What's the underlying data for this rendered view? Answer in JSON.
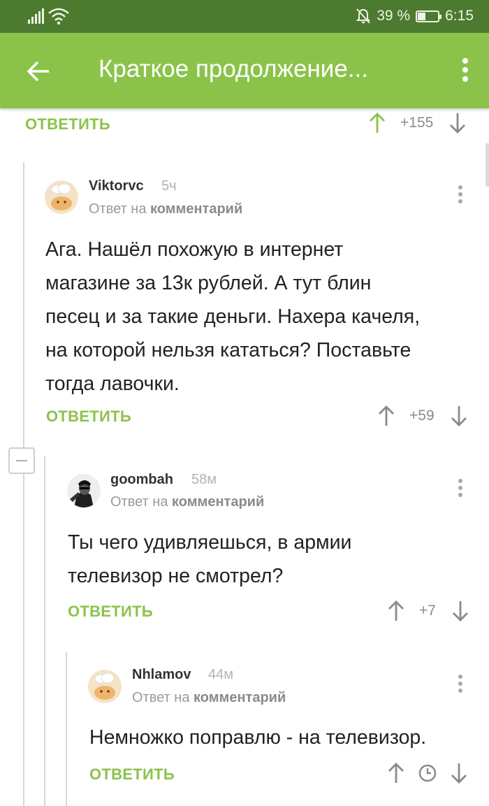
{
  "status_bar": {
    "battery_percent": "39 %",
    "battery_level": 0.39,
    "time": "6:15",
    "icons": [
      "signal-icon",
      "wifi-icon",
      "mute-bell-icon",
      "battery-icon"
    ]
  },
  "app_bar": {
    "title": "Краткое продолжение...",
    "back_icon": "arrow-left-icon",
    "menu_icon": "more-vert-icon"
  },
  "colors": {
    "brand": "#8bc34a",
    "status_bar": "#4c7a2e",
    "upvote_active": "#8bc34a",
    "inactive": "#8a8a8a"
  },
  "top_action": {
    "reply_label": "ОТВЕТИТЬ",
    "rating": "+155"
  },
  "comments": [
    {
      "author": "Viktorvc",
      "time": "5ч",
      "reply_to_prefix": "Ответ на",
      "reply_to_target": "комментарий",
      "text_lines": [
        "Ага. Нашёл похожую в интернет",
        "магазине за 13к рублей. А тут блин",
        "песец и за такие деньги. Нахера качеля,",
        "на которой нельзя кататься? Поставьте",
        "тогда лавочки."
      ],
      "reply_label": "ОТВЕТИТЬ",
      "rating": "+59"
    },
    {
      "author": "goombah",
      "time": "58м",
      "reply_to_prefix": "Ответ на",
      "reply_to_target": "комментарий",
      "text_lines": [
        "Ты чего удивляешься, в армии",
        "телевизор не смотрел?"
      ],
      "reply_label": "ОТВЕТИТЬ",
      "rating": "+7"
    },
    {
      "author": "Nhlamov",
      "time": "44м",
      "reply_to_prefix": "Ответ на",
      "reply_to_target": "комментарий",
      "text_lines": [
        "Немножко поправлю - на телевизор."
      ],
      "reply_label": "ОТВЕТИТЬ",
      "rating_icon": "clock-icon"
    }
  ]
}
